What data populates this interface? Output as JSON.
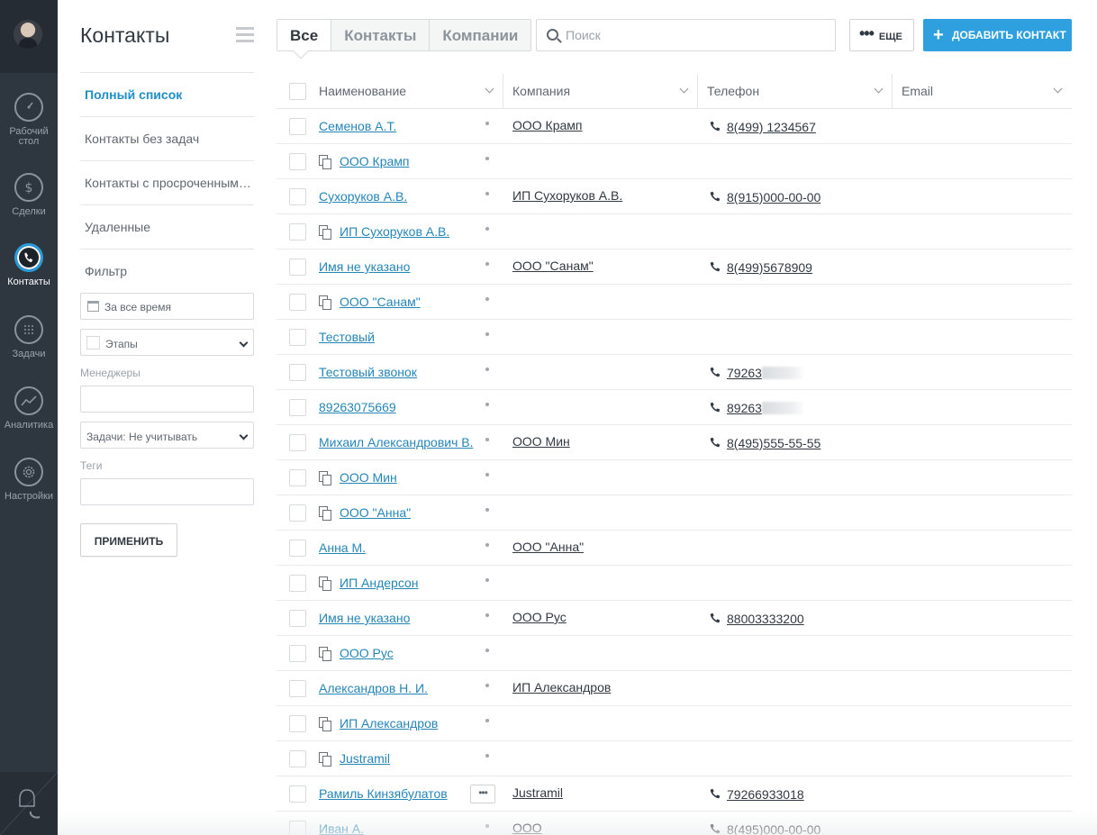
{
  "rail": {
    "items": [
      {
        "label_1": "Рабочий",
        "label_2": "стол",
        "icon": "dashboard-gauge-icon"
      },
      {
        "label_1": "Сделки",
        "label_2": "",
        "icon": "dollar-icon"
      },
      {
        "label_1": "Контакты",
        "label_2": "",
        "icon": "phone-icon",
        "active": true
      },
      {
        "label_1": "Задачи",
        "label_2": "",
        "icon": "calendar-grid-icon"
      },
      {
        "label_1": "Аналитика",
        "label_2": "",
        "icon": "chart-line-icon"
      },
      {
        "label_1": "Настройки",
        "label_2": "",
        "icon": "gear-icon"
      }
    ]
  },
  "sidebar": {
    "title": "Контакты",
    "items": [
      {
        "label": "Полный список",
        "active": true
      },
      {
        "label": "Контакты без задач"
      },
      {
        "label": "Контакты с просроченными задачами"
      },
      {
        "label": "Удаленные"
      },
      {
        "label": "Фильтр"
      }
    ],
    "filter": {
      "period": "За все время",
      "stages": "Этапы",
      "managers_label": "Менеджеры",
      "managers_value": "",
      "tasks": "Задачи: Не учитывать",
      "tags_label": "Теги",
      "tags_value": "",
      "apply": "ПРИМЕНИТЬ"
    }
  },
  "toolbar": {
    "tabs": [
      "Все",
      "Контакты",
      "Компании"
    ],
    "active_tab": "Все",
    "search_placeholder": "Поиск",
    "more_label": "ЕЩЕ",
    "add_label": "ДОБАВИТЬ КОНТАКТ"
  },
  "table": {
    "columns": [
      "Наименование",
      "Компания",
      "Телефон",
      "Email"
    ],
    "rows": [
      {
        "name": "Семенов А.Т.",
        "company_row": false,
        "company": "ООО Крамп",
        "phone": "8(499) 1234567",
        "phone_blur": false
      },
      {
        "name": "ООО Крамп",
        "company_row": true,
        "company": "",
        "phone": "",
        "phone_blur": false
      },
      {
        "name": "Сухоруков А.В.",
        "company_row": false,
        "company": "ИП Сухоруков А.В.",
        "phone": "8(915)000-00-00",
        "phone_blur": false
      },
      {
        "name": "ИП Сухоруков А.В.",
        "company_row": true,
        "company": "",
        "phone": "",
        "phone_blur": false
      },
      {
        "name": "Имя не указано",
        "company_row": false,
        "company": "ООО \"Санам\"",
        "phone": "8(499)5678909",
        "phone_blur": false
      },
      {
        "name": "ООО \"Санам\"",
        "company_row": true,
        "company": "",
        "phone": "",
        "phone_blur": false
      },
      {
        "name": "Тестовый",
        "company_row": false,
        "company": "",
        "phone": "",
        "phone_blur": false
      },
      {
        "name": "Тестовый звонок",
        "company_row": false,
        "company": "",
        "phone": "79263",
        "phone_blur": true
      },
      {
        "name": "89263075669",
        "company_row": false,
        "company": "",
        "phone": "89263",
        "phone_blur": true
      },
      {
        "name": "Михаил Александрович В.",
        "company_row": false,
        "company": "ООО Мин",
        "phone": "8(495)555-55-55",
        "phone_blur": false
      },
      {
        "name": "ООО Мин",
        "company_row": true,
        "company": "",
        "phone": "",
        "phone_blur": false
      },
      {
        "name": "ООО \"Анна\"",
        "company_row": true,
        "company": "",
        "phone": "",
        "phone_blur": false
      },
      {
        "name": "Анна М.",
        "company_row": false,
        "company": "ООО \"Анна\"",
        "phone": "",
        "phone_blur": false
      },
      {
        "name": "ИП Андерсон",
        "company_row": true,
        "company": "",
        "phone": "",
        "phone_blur": false
      },
      {
        "name": "Имя не указано",
        "company_row": false,
        "company": "ООО Рус",
        "phone": "88003333200",
        "phone_blur": false
      },
      {
        "name": "ООО Рус",
        "company_row": true,
        "company": "",
        "phone": "",
        "phone_blur": false
      },
      {
        "name": "Александров Н. И.",
        "company_row": false,
        "company": "ИП Александров",
        "phone": "",
        "phone_blur": false
      },
      {
        "name": "ИП Александров",
        "company_row": true,
        "company": "",
        "phone": "",
        "phone_blur": false
      },
      {
        "name": "Justramil",
        "company_row": true,
        "company": "",
        "phone": "",
        "phone_blur": false
      },
      {
        "name": "Рамиль Кинзябулатов",
        "company_row": false,
        "company": "Justramil",
        "phone": "79266933018",
        "phone_blur": false,
        "row_menu": "•••"
      },
      {
        "name": "Иван А.",
        "company_row": false,
        "company": "ООО",
        "phone": "8(495)000-00-00",
        "phone_blur": false
      }
    ]
  },
  "colors": {
    "rail_bg": "#2e3640",
    "accent": "#2fa0df",
    "link": "#2586b8"
  }
}
